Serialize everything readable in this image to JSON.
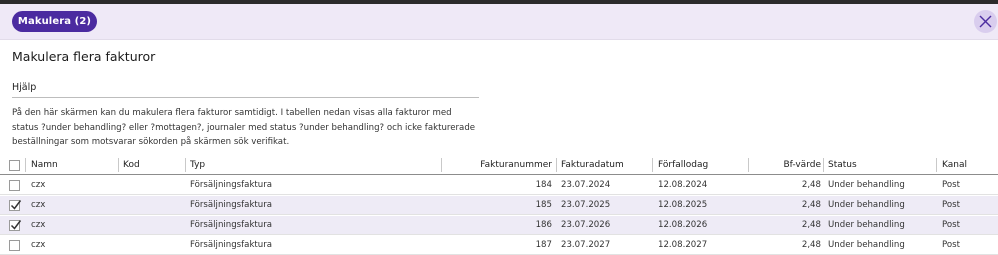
{
  "header": {
    "pill_label": "Makulera (2)",
    "close_icon": "close-icon"
  },
  "title": "Makulera flera fakturor",
  "help": {
    "heading": "Hjälp",
    "lines": [
      "På den här skärmen kan du makulera flera fakturor samtidigt. I tabellen nedan visas alla fakturor med",
      "status ?under behandling? eller ?mottagen?, journaler med status ?under behandling? och icke fakturerade",
      "beställningar som motsvarar sökorden på skärmen sök verifikat."
    ]
  },
  "table": {
    "columns": [
      "Namn",
      "Kod",
      "Typ",
      "Fakturanummer",
      "Fakturadatum",
      "Förfallodag",
      "Bf-värde",
      "Status",
      "Kanal"
    ],
    "rows": [
      {
        "checked": false,
        "namn": "czx",
        "kod": "",
        "typ": "Försäljningsfaktura",
        "fakturanummer": "184",
        "fakturadatum": "23.07.2024",
        "forfallodag": "12.08.2024",
        "bfvarde": "2,48",
        "status": "Under behandling",
        "kanal": "Post"
      },
      {
        "checked": true,
        "namn": "czx",
        "kod": "",
        "typ": "Försäljningsfaktura",
        "fakturanummer": "185",
        "fakturadatum": "23.07.2025",
        "forfallodag": "12.08.2025",
        "bfvarde": "2,48",
        "status": "Under behandling",
        "kanal": "Post"
      },
      {
        "checked": true,
        "namn": "czx",
        "kod": "",
        "typ": "Försäljningsfaktura",
        "fakturanummer": "186",
        "fakturadatum": "23.07.2026",
        "forfallodag": "12.08.2026",
        "bfvarde": "2,48",
        "status": "Under behandling",
        "kanal": "Post"
      },
      {
        "checked": false,
        "namn": "czx",
        "kod": "",
        "typ": "Försäljningsfaktura",
        "fakturanummer": "187",
        "fakturadatum": "23.07.2027",
        "forfallodag": "12.08.2027",
        "bfvarde": "2,48",
        "status": "Under behandling",
        "kanal": "Post"
      }
    ]
  },
  "colors": {
    "accent": "#4b2ba0",
    "header_bg": "#efe9f7",
    "selected_row_bg": "#eeebf6"
  }
}
